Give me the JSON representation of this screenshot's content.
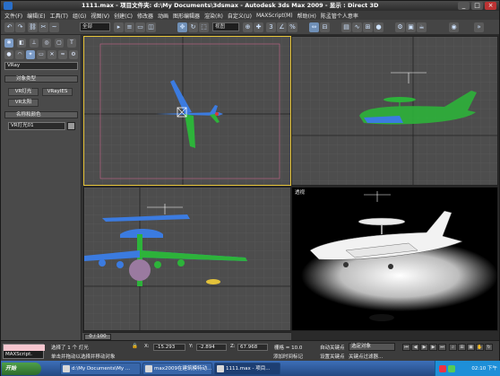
{
  "window": {
    "title": "1111.max  - 项目文件夹: d:\\My Documents\\3dsmax  - Autodesk 3ds Max  2009    - 显示 : Direct 3D"
  },
  "menubar": {
    "items": [
      "文件(F)",
      "编辑(E)",
      "工具(T)",
      "组(G)",
      "视图(V)",
      "创建(C)",
      "修改器",
      "动画",
      "图形编辑器",
      "渲染(R)",
      "自定义(U)",
      "MAXScript(M)",
      "帮助(H)",
      "陈孟管个人意率"
    ]
  },
  "toolbar": {
    "selection_filter": "全部",
    "ref_coord": "视图"
  },
  "command_panel": {
    "category_dropdown": "VRay",
    "rollout_object_type": "对象类型",
    "btn_vray_light": "VR灯光",
    "btn_vray_ies": "VRayIES",
    "btn_vray_sun": "VR太阳",
    "rollout_name_color": "名称和颜色",
    "name_value": "VR灯光01"
  },
  "viewports": {
    "perspective_label": "透视"
  },
  "timeslider": {
    "position": "0 / 100"
  },
  "status": {
    "selection_info": "选择了 1 个 灯光",
    "prompt": "单击并拖动以选择并移动对象",
    "x_value": "-15.293",
    "y_value": "-2.894",
    "z_value": "67.968",
    "grid": "栅格 = 10.0",
    "add_time_tag": "添加时间标记",
    "auto_key": "自动关键点",
    "selected_object": "选定对象",
    "set_key": "设置关键点",
    "key_filters": "关键点过滤器...",
    "maxscript_label": "MAXScript."
  },
  "taskbar": {
    "start_label": "开始",
    "tasks": [
      "d:\\My Documents\\My ...",
      "max2009在建筑模特动...",
      "1111.max - 项目..."
    ],
    "clock": "02:10 下午"
  },
  "colors": {
    "active_viewport_border": "#e7c53a",
    "selection_blue": "#7c9cc7",
    "taskbar_blue": "#2a57a0",
    "airplane_blue": "#3b7be0",
    "airplane_green": "#2db33a"
  }
}
